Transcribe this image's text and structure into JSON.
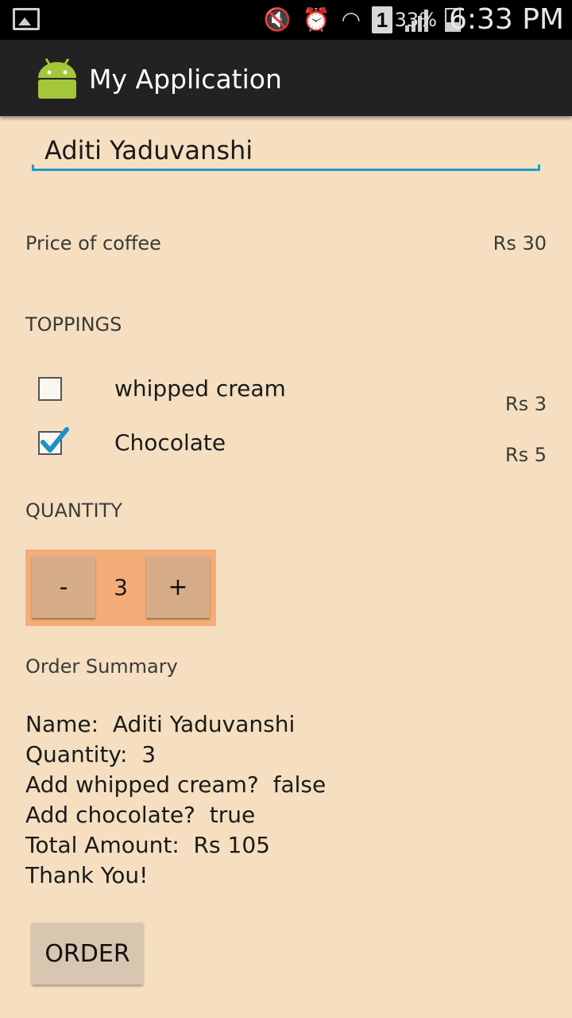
{
  "status_bar": {
    "battery_percent": "33%",
    "sim_slot": "1",
    "time": "6:33 PM",
    "icons": [
      "gallery-icon",
      "mute-vibrate-icon",
      "alarm-icon",
      "wifi-icon",
      "sim-icon",
      "signal-icon",
      "battery-icon"
    ]
  },
  "action_bar": {
    "title": "My Application",
    "logo": "android-logo-icon"
  },
  "form": {
    "name_value": "Aditi Yaduvanshi",
    "accent_color": "#1a9fd0",
    "price_label": "Price of coffee",
    "price_value": "Rs 30",
    "toppings_label": "TOPPINGS",
    "toppings": [
      {
        "label": "whipped cream",
        "price": "Rs 3",
        "checked": false
      },
      {
        "label": "Chocolate",
        "price": "Rs 5",
        "checked": true
      }
    ],
    "quantity_label": "QUANTITY",
    "quantity": {
      "minus": "-",
      "value": "3",
      "plus": "+"
    },
    "summary_title": "Order Summary",
    "summary_lines": [
      "Name:  Aditi Yaduvanshi",
      "Quantity:  3",
      "Add whipped cream?  false",
      "Add chocolate?  true",
      "Total Amount:  Rs 105",
      "Thank You!"
    ],
    "order_button": "ORDER"
  },
  "colors": {
    "background": "#f5dfc0",
    "stepper_bg": "#f4ad78",
    "button_bg": "#d6ad88",
    "action_bar": "#222222"
  }
}
